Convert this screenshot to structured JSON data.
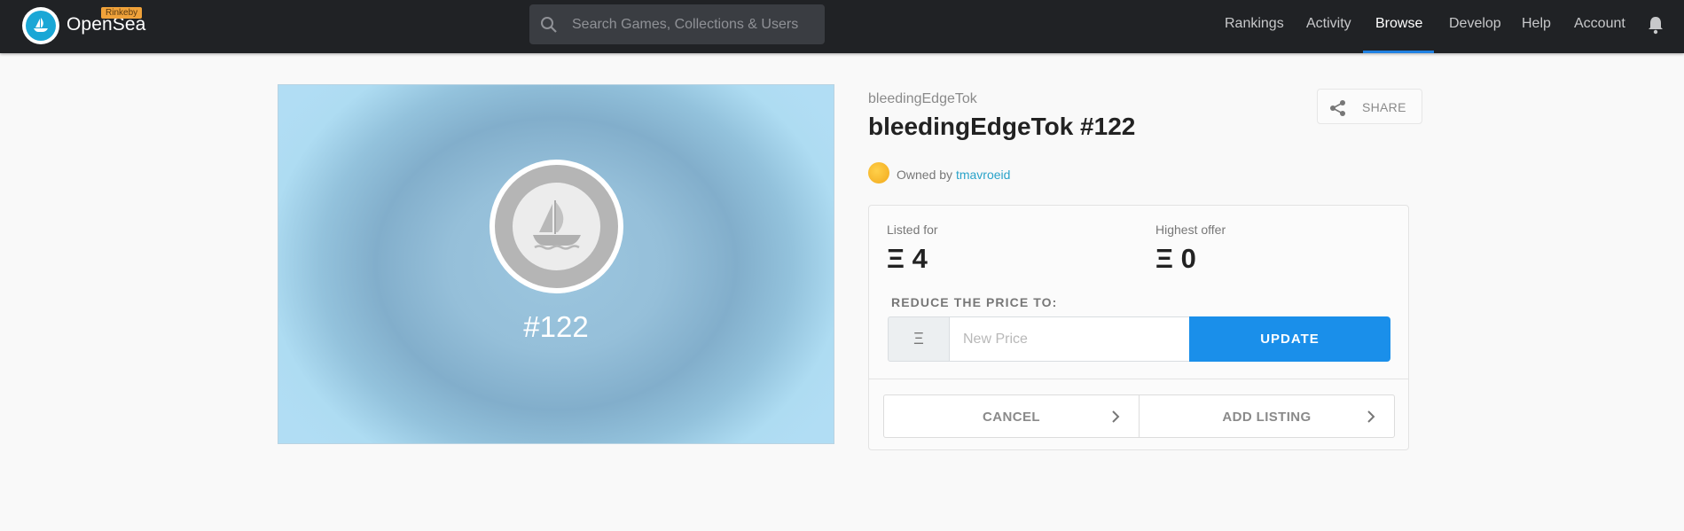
{
  "nav": {
    "brand": "OpenSea",
    "badge": "Rinkeby",
    "search_placeholder": "Search Games, Collections & Users",
    "items": [
      {
        "label": "Rankings"
      },
      {
        "label": "Activity"
      },
      {
        "label": "Browse",
        "active": true
      },
      {
        "label": "Develop"
      },
      {
        "label": "Help"
      },
      {
        "label": "Account"
      }
    ],
    "accent_color": "#2081e2"
  },
  "asset": {
    "image_label": "#122",
    "collection": "bleedingEdgeTok",
    "title": "bleedingEdgeTok #122",
    "share_label": "SHARE",
    "owned_by_label": "Owned by",
    "owner": "tmavroeid"
  },
  "price_card": {
    "listed_label": "Listed for",
    "listed_value": "Ξ 4",
    "offer_label": "Highest offer",
    "offer_value": "Ξ 0",
    "reduce_label": "REDUCE THE PRICE TO:",
    "currency_symbol": "Ξ",
    "input_placeholder": "New Price",
    "update_label": "UPDATE",
    "cancel_label": "CANCEL",
    "add_listing_label": "ADD LISTING",
    "button_color": "#1a8fea"
  }
}
